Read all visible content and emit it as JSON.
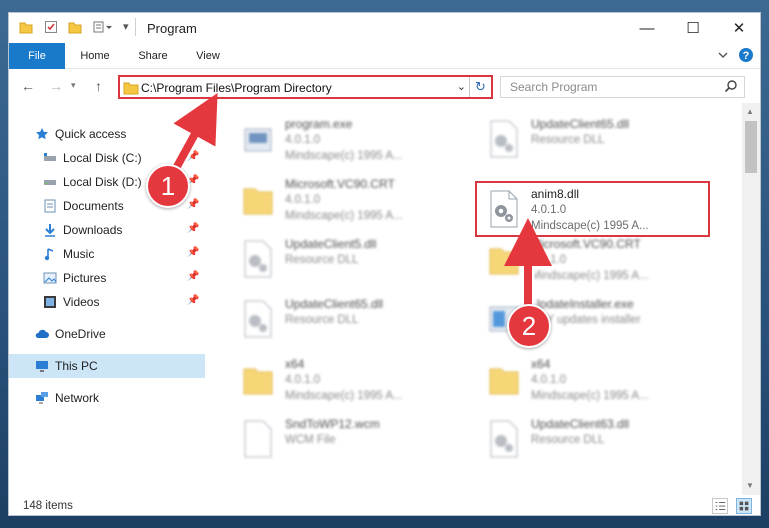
{
  "window": {
    "title": "Program",
    "controls": {
      "minimize": "—",
      "maximize": "☐",
      "close": "✕"
    }
  },
  "ribbon": {
    "tabs": [
      "File",
      "Home",
      "Share",
      "View"
    ]
  },
  "address_bar": {
    "path": "C:\\Program Files\\Program Directory",
    "back": "←",
    "forward": "→",
    "up": "↑"
  },
  "search": {
    "placeholder": "Search Program"
  },
  "sidebar": {
    "items": [
      {
        "label": "Quick access",
        "icon": "star-icon"
      },
      {
        "label": "Local Disk (C:)",
        "icon": "drive-icon",
        "pinned": true
      },
      {
        "label": "Local Disk (D:)",
        "icon": "drive-icon",
        "pinned": true
      },
      {
        "label": "Documents",
        "icon": "documents-icon",
        "pinned": true
      },
      {
        "label": "Downloads",
        "icon": "downloads-icon",
        "pinned": true
      },
      {
        "label": "Music",
        "icon": "music-icon",
        "pinned": true
      },
      {
        "label": "Pictures",
        "icon": "pictures-icon",
        "pinned": true
      },
      {
        "label": "Videos",
        "icon": "videos-icon",
        "pinned": true
      },
      {
        "label": "OneDrive",
        "icon": "cloud-icon"
      },
      {
        "label": "This PC",
        "icon": "computer-icon",
        "selected": true
      },
      {
        "label": "Network",
        "icon": "network-icon"
      }
    ]
  },
  "files": {
    "items": [
      {
        "name": "program.exe",
        "line2": "4.0.1.0",
        "line3": "Mindscape(c) 1995 A...",
        "icon": "exe-icon"
      },
      {
        "name": "UpdateClient65.dll",
        "line2": "Resource DLL",
        "line3": "",
        "icon": "dll-icon"
      },
      {
        "name": "Microsoft.VC90.CRT",
        "line2": "4.0.1.0",
        "line3": "Mindscape(c) 1995 A...",
        "icon": "folder-icon"
      },
      {
        "name": "anim8.dll",
        "line2": "4.0.1.0",
        "line3": "Mindscape(c) 1995 A...",
        "icon": "dll-icon"
      },
      {
        "name": "UpdateClient5.dll",
        "line2": "Resource DLL",
        "line3": "",
        "icon": "dll-icon"
      },
      {
        "name": "Microsoft.VC90.CRT",
        "line2": "4.0.1.0",
        "line3": "Mindscape(c) 1995 A...",
        "icon": "folder-icon"
      },
      {
        "name": "UpdateClient65.dll",
        "line2": "Resource DLL",
        "line3": "",
        "icon": "dll-icon"
      },
      {
        "name": "UpdateInstaller.exe",
        "line2": "BBY updates installer",
        "line3": "",
        "icon": "installer-icon"
      },
      {
        "name": "x64",
        "line2": "4.0.1.0",
        "line3": "Mindscape(c) 1995 A...",
        "icon": "folder-icon"
      },
      {
        "name": "x64",
        "line2": "4.0.1.0",
        "line3": "Mindscape(c) 1995 A...",
        "icon": "folder-icon"
      },
      {
        "name": "SndToWP12.wcm",
        "line2": "WCM File",
        "line3": "",
        "icon": "file-icon"
      },
      {
        "name": "UpdateClient63.dll",
        "line2": "Resource DLL",
        "line3": "",
        "icon": "dll-icon"
      }
    ]
  },
  "status": {
    "item_count": "148 items"
  },
  "annotations": [
    {
      "number": "1"
    },
    {
      "number": "2"
    }
  ],
  "colors": {
    "accent": "#1979ca",
    "highlight": "#d9373f",
    "selected_nav": "#cce5f7"
  }
}
